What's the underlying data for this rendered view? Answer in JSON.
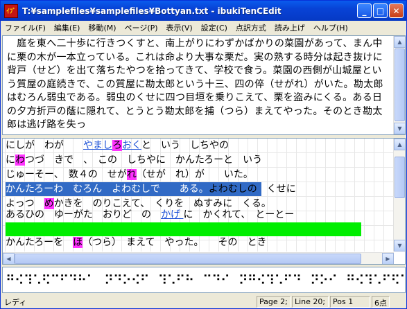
{
  "window": {
    "title": "T:¥samplefiles¥samplefiles¥Bottyan.txt - ibukiTenCEdit",
    "icon_text": "ｲﾌﾞ"
  },
  "menu": [
    "ファイル(F)",
    "編集(E)",
    "移動(M)",
    "ページ(P)",
    "表示(V)",
    "設定(C)",
    "点訳方式",
    "読み上げ",
    "ヘルプ(H)"
  ],
  "source_text": "　庭を東へ二十歩に行きつくすと、南上がりにわずかばかりの菜園があって、まん中に栗の木が一本立っている。これは命より大事な栗だ。実の熟する時分は起き抜けに背戸（せど）を出て落ちたやつを拾ってきて、学校で食う。菜園の西側が山城屋という質屋の庭続きで、この質屋に勘太郎という十三、四の倅（せがれ）がいた。勘太郎はむろん弱虫である。弱虫のくせに四つ目垣を乗りこえて、栗を盗みにくる。ある日の夕方折戸の蔭に隠れて、とうとう勘太郎を捕（つら）まえてやった。そのとき勘太郎は逃げ路を失っ",
  "braille_lines": [
    {
      "a": "にしが　わが　　",
      "link": "やまし",
      "m": "ろ",
      "b": "",
      "link2": "おく",
      "c": "と　いう　しちやの"
    },
    {
      "a": "に",
      "m": "わ",
      "c": "つづ　きで　、　この　しちやに　かんたろーと　いう"
    },
    {
      "a": "じゅーそー、　数４の　せが",
      "m": "れ",
      "c": "（せが　れ）が　　いた。"
    },
    {
      "sel": "かんたろーわ　むろん　よわむしで　　ある。",
      "c": "よわむしの　くせに"
    },
    {
      "a": "よっつ　",
      "m": "め",
      "c": "かきを　のりこえて、　くりを　ぬすみに　くる。"
    },
    {
      "a": "あるひの　ゆーがた　おりど　の　",
      "link": "かげ ",
      "c": "に　かくれて、　とーとー"
    },
    {
      "a": "",
      "c": ""
    },
    {
      "a": "かんたろーを　",
      "m": "ほ",
      "c": "（つら）　まえて　やった。　　その　とき"
    }
  ],
  "braille_cells": "⠛⠪⠹⠡⠫⠉⠋⠙⠓⠁⠀⠝⠙⠕⠪⠋⠀⠹⠡⠋⠓⠀⠉⠙⠊⠀⠝⠛⠪⠹⠡⠋⠙⠀⠝⠕⠊⠀⠛⠪⠹⠡⠋⠫⠉⠀⠟⠍⠹⠡⠋⠀⠙⠊⠹⠡⠋⠀⠝⠛⠪⠹",
  "status": {
    "mode": "レディ",
    "page": "Page 2;",
    "line": "Line 20;",
    "pos": "Pos 1",
    "cells": "6点"
  }
}
